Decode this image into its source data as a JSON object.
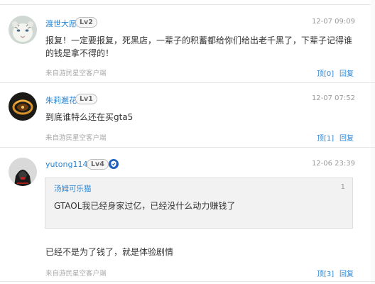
{
  "comments": [
    {
      "username": "渡世大愿",
      "level": "Lv2",
      "time": "12-07 09:09",
      "content": "报复！一定要报复，死黑店，一辈子的积蓄都给你们给出老千黑了，下辈子记得谁的钱是拿不得的！",
      "source": "来自游民星空客户端",
      "like_label": "顶[0]",
      "reply_label": "回复",
      "avatar_icon": "white-tiger-avatar"
    },
    {
      "username": "朱莉邂花",
      "level": "Lv1",
      "time": "12-07 07:52",
      "content": "到底谁特么还在买gta5",
      "source": "来自游民星空客户端",
      "like_label": "顶[1]",
      "reply_label": "回复",
      "avatar_icon": "fire-ring-avatar"
    },
    {
      "username": "yutong1145",
      "level": "Lv4",
      "time": "12-06 23:39",
      "quote": {
        "username": "汤姆可乐猫",
        "floor": "1",
        "text": "GTAOL我已经身家过亿，已经没什么动力赚钱了"
      },
      "content": "已经不是为了钱了，就是体验剧情",
      "source": "来自游民星空客户端",
      "like_label": "顶[3]",
      "reply_label": "回复",
      "avatar_icon": "assassin-avatar",
      "badge_icon": "shield-badge-icon"
    }
  ],
  "colors": {
    "link": "#2a86d4",
    "meta": "#aaaaaa",
    "separator": "#e5e5e5"
  }
}
